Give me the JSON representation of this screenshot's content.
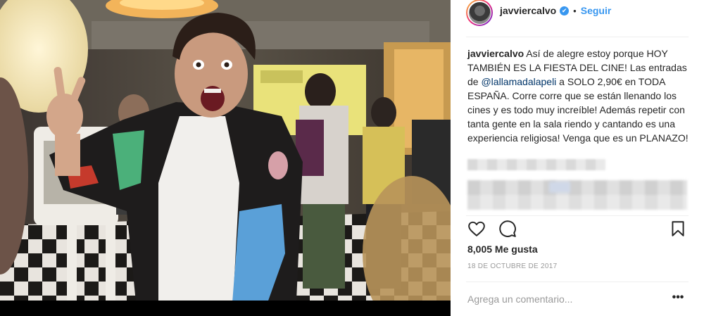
{
  "post": {
    "username": "javviercalvo",
    "verified_mark": "✔",
    "separator": "•",
    "follow_label": "Seguir",
    "caption": {
      "author": "javviercalvo",
      "part1": " Así de alegre estoy porque HOY TAMBIÉN ES LA FIESTA DEL CINE! Las entradas de ",
      "mention": "@lallamadalapeli",
      "part2": " a SOLO 2,90€ en TODA ESPAÑA. Corre corre que se están llenando los cines y es todo muy increíble! Además repetir con tanta gente en la sala riendo y cantando es una experiencia religiosa! Venga que es un PLANAZO!"
    },
    "likes": "8,005 Me gusta",
    "date": "18 DE OCTUBRE DE 2017",
    "comment_placeholder": "Agrega un comentario...",
    "more_label": "•••"
  },
  "icons": {
    "like": "heart-icon",
    "comment": "comment-bubble-icon",
    "save": "bookmark-icon",
    "verified": "verified-badge-icon"
  },
  "colors": {
    "accent": "#3897f0",
    "mention": "#003569",
    "muted": "#999999",
    "text": "#262626",
    "divider": "#efefef"
  }
}
